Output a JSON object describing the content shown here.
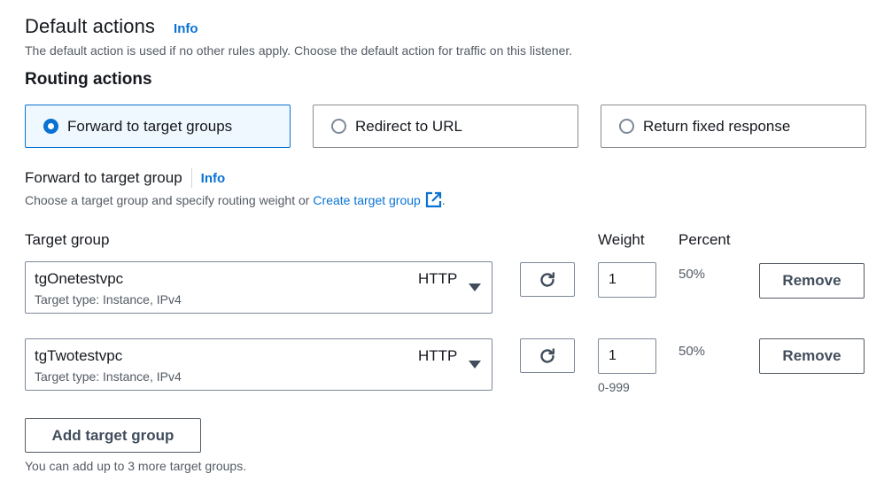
{
  "header": {
    "title": "Default actions",
    "info": "Info",
    "description": "The default action is used if no other rules apply. Choose the default action for traffic on this listener."
  },
  "routing": {
    "title": "Routing actions",
    "options": [
      {
        "label": "Forward to target groups",
        "selected": true
      },
      {
        "label": "Redirect to URL",
        "selected": false
      },
      {
        "label": "Return fixed response",
        "selected": false
      }
    ]
  },
  "forward": {
    "title": "Forward to target group",
    "info": "Info",
    "desc_prefix": "Choose a target group and specify routing weight or",
    "create_link": "Create target group",
    "desc_suffix": "."
  },
  "columns": {
    "target_group": "Target group",
    "weight": "Weight",
    "percent": "Percent"
  },
  "target_groups": [
    {
      "name": "tgOnetestvpc",
      "protocol": "HTTP",
      "subtitle": "Target type: Instance, IPv4",
      "weight": "1",
      "percent": "50%",
      "remove_label": "Remove"
    },
    {
      "name": "tgTwotestvpc",
      "protocol": "HTTP",
      "subtitle": "Target type: Instance, IPv4",
      "weight": "1",
      "percent": "50%",
      "remove_label": "Remove"
    }
  ],
  "weight_hint": "0-999",
  "add_button": "Add target group",
  "footer_note": "You can add up to 3 more target groups.",
  "colors": {
    "accent": "#0972d3",
    "selected_bg": "#f0f8ff",
    "text": "#16191f",
    "muted": "#545b64"
  }
}
